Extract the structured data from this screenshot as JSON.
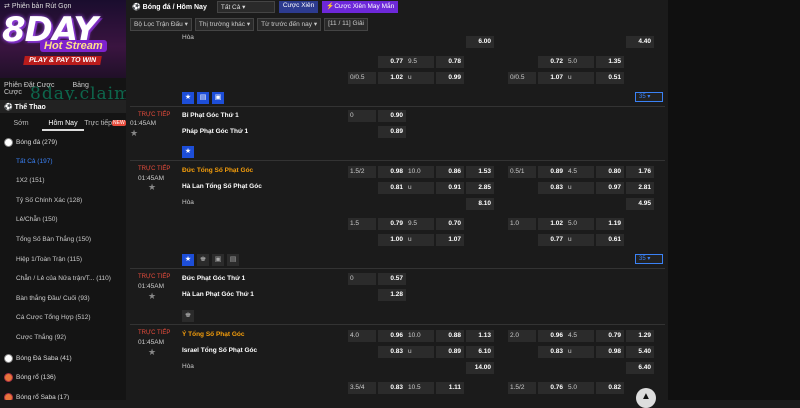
{
  "header": {
    "promo_label": "Phiên bản Rút Gọn",
    "logo_text": "8DAY",
    "hot_stream": "Hot Stream",
    "pay_to_win": "PLAY & PAY TO WIN",
    "watermark": "8day.claims"
  },
  "sidebar": {
    "nav": [
      "Phiên Đặt Cược",
      "Bảng Cược"
    ],
    "sport": "Thể Thao",
    "time_tabs": [
      "Sớm",
      "Hôm Nay",
      "Trực tiếp"
    ],
    "live_badge": "NEW",
    "items": [
      {
        "label": "Bóng đá  (279)",
        "type": "cat"
      },
      {
        "label": "Tất Cả  (197)",
        "type": "selected"
      },
      {
        "label": "1X2  (151)",
        "type": "sub"
      },
      {
        "label": "Tỷ Số Chính Xác  (128)",
        "type": "sub"
      },
      {
        "label": "Lẻ/Chẵn  (150)",
        "type": "sub"
      },
      {
        "label": "Tổng Số Bàn Thắng  (150)",
        "type": "sub"
      },
      {
        "label": "Hiệp 1/Toàn Trận  (115)",
        "type": "sub"
      },
      {
        "label": "Chẵn / Lẻ của Nửa trận/T...  (110)",
        "type": "sub"
      },
      {
        "label": "Bàn thắng Đầu/ Cuối  (93)",
        "type": "sub"
      },
      {
        "label": "Cá Cược Tổng Hợp  (512)",
        "type": "sub"
      },
      {
        "label": "Cược Thắng  (92)",
        "type": "sub"
      },
      {
        "label": "Bóng Đá Saba  (41)",
        "type": "cat"
      },
      {
        "label": "Bóng rổ  (136)",
        "type": "cat-basket"
      },
      {
        "label": "Bóng rổ Saba  (17)",
        "type": "cat-basket"
      }
    ]
  },
  "topbar": {
    "title": "Bóng đá / Hôm Nay",
    "select_all": "Tất Cả",
    "parlay": "Cược Xiên",
    "lucky_parlay": "Cược Xiên May Mắn"
  },
  "filters": [
    "Bộ Lọc Trận Đấu",
    "Thị trường khác",
    "Từ trước đến nay",
    "[11 / 11] Giải"
  ],
  "matches": {
    "live": "TRỰC TIẾP",
    "time": "01:45AM",
    "draw": "Hòa",
    "m0": {
      "draw_odds_a": "6.00",
      "draw_odds_b": "4.40",
      "r1": [
        "0.77",
        "9.5",
        "0.78",
        "0.72",
        "5.0",
        "1.35"
      ],
      "r2": [
        "0/0.5",
        "1.02",
        "u",
        "0.99",
        "0/0.5",
        "1.07",
        "u",
        "0.51"
      ]
    },
    "m1": {
      "home": "Bỉ Phạt Góc Thứ 1",
      "away": "Pháp Phạt Góc Thứ 1",
      "h": "0",
      "o1": "0.90",
      "o2": "0.89"
    },
    "m2": {
      "home": "Đức Tổng Số Phạt Góc",
      "away": "Hà Lan Tổng Số Phạt Góc",
      "r1": [
        "1.5/2",
        "0.98",
        "10.0",
        "0.86",
        "1.53",
        "0.5/1",
        "0.89",
        "4.5",
        "0.80",
        "1.76"
      ],
      "r2": [
        "0.81",
        "u",
        "0.91",
        "2.85",
        "0.83",
        "u",
        "0.97",
        "2.81"
      ],
      "r3": [
        "8.10",
        "4.95"
      ],
      "r4": [
        "1.5",
        "0.79",
        "9.5",
        "0.70",
        "1.0",
        "1.02",
        "5.0",
        "1.19"
      ],
      "r5": [
        "1.00",
        "u",
        "1.07",
        "0.77",
        "u",
        "0.61"
      ]
    },
    "m3": {
      "home": "Đức Phạt Góc Thứ 1",
      "away": "Hà Lan Phạt Góc Thứ 1",
      "h": "0",
      "o1": "0.57",
      "o2": "1.28"
    },
    "m4": {
      "home": "Ý Tổng Số Phạt Góc",
      "away": "Israel Tổng Số Phạt Góc",
      "r1": [
        "4.0",
        "0.96",
        "10.0",
        "0.88",
        "1.13",
        "2.0",
        "0.96",
        "4.5",
        "0.79",
        "1.29"
      ],
      "r2": [
        "0.83",
        "u",
        "0.89",
        "6.10",
        "0.83",
        "u",
        "0.98",
        "5.40"
      ],
      "r3": [
        "14.00",
        "6.40"
      ],
      "r4": [
        "3.5/4",
        "0.83",
        "10.5",
        "1.11",
        "1.5/2",
        "0.76",
        "5.0",
        "0.82"
      ]
    },
    "pager": "35"
  }
}
